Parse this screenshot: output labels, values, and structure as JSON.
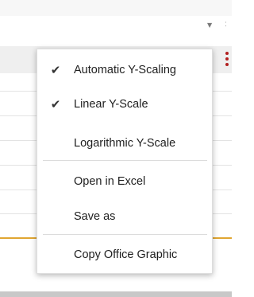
{
  "context_menu": {
    "items": [
      {
        "label": "Automatic Y-Scaling",
        "checked": true
      },
      {
        "label": "Linear Y-Scale",
        "checked": true
      },
      {
        "label": "Logarithmic Y-Scale",
        "checked": false
      },
      {
        "label": "Open in Excel",
        "checked": false
      },
      {
        "label": "Save as",
        "checked": false
      },
      {
        "label": "Copy Office Graphic",
        "checked": false
      }
    ],
    "check_glyph": "✔"
  },
  "colors": {
    "kebab": "#b21f1f",
    "series_line": "#e0a632",
    "header_band": "#efefef"
  },
  "icons": {
    "kebab": "more-vertical-icon",
    "dropdown": "chevron-down-icon"
  }
}
